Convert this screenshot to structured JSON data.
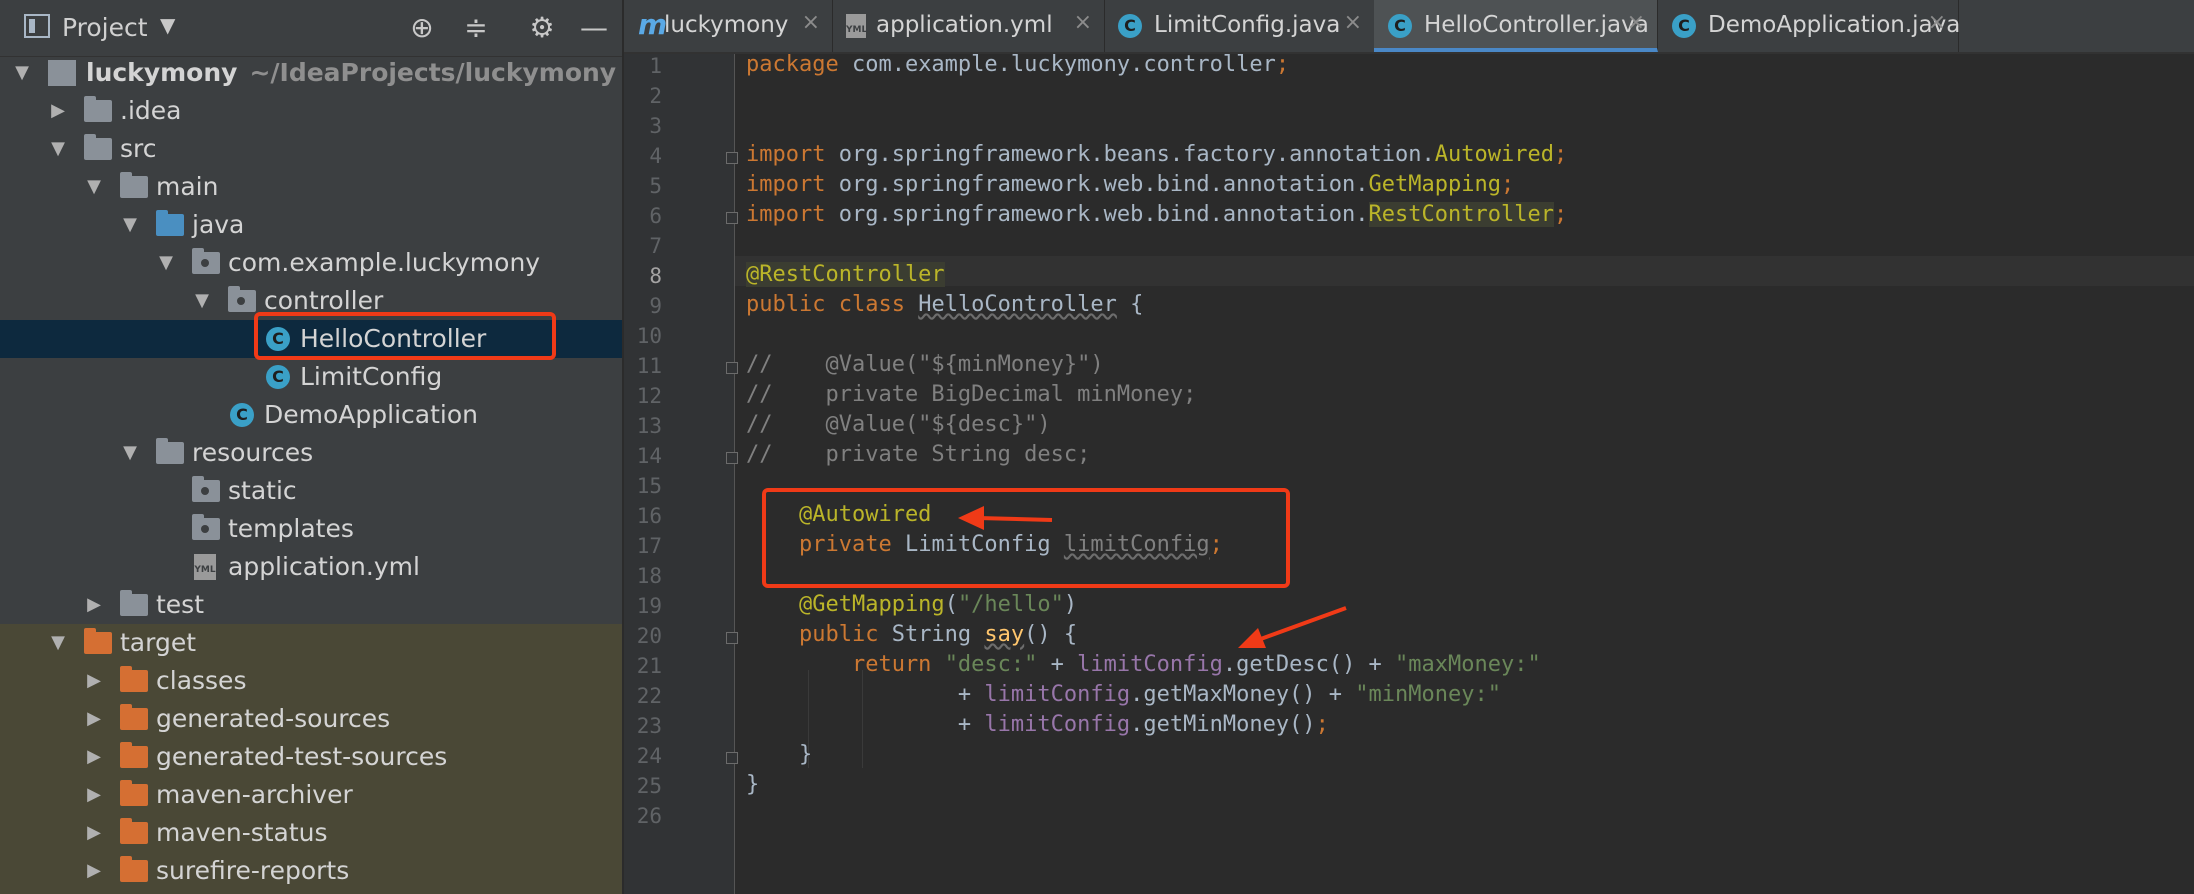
{
  "project_panel": {
    "title": "Project",
    "tree": [
      {
        "label": "luckymony",
        "sub": "~/IdeaProjects/luckymony"
      },
      {
        "label": ".idea"
      },
      {
        "label": "src"
      },
      {
        "label": "main"
      },
      {
        "label": "java"
      },
      {
        "label": "com.example.luckymony"
      },
      {
        "label": "controller"
      },
      {
        "label": "HelloController"
      },
      {
        "label": "LimitConfig"
      },
      {
        "label": "DemoApplication"
      },
      {
        "label": "resources"
      },
      {
        "label": "static"
      },
      {
        "label": "templates"
      },
      {
        "label": "application.yml"
      },
      {
        "label": "test"
      },
      {
        "label": "target"
      },
      {
        "label": "classes"
      },
      {
        "label": "generated-sources"
      },
      {
        "label": "generated-test-sources"
      },
      {
        "label": "maven-archiver"
      },
      {
        "label": "maven-status"
      },
      {
        "label": "surefire-reports"
      }
    ]
  },
  "tabs": [
    {
      "label": "luckymony",
      "icon": "m"
    },
    {
      "label": "application.yml",
      "icon": "YML"
    },
    {
      "label": "LimitConfig.java",
      "icon": "C"
    },
    {
      "label": "HelloController.java",
      "icon": "C"
    },
    {
      "label": "DemoApplication.java",
      "icon": "C"
    }
  ],
  "tab_close_glyph": "×",
  "line_numbers": [
    "1",
    "2",
    "3",
    "4",
    "5",
    "6",
    "7",
    "8",
    "9",
    "10",
    "11",
    "12",
    "13",
    "14",
    "15",
    "16",
    "17",
    "18",
    "19",
    "20",
    "21",
    "22",
    "23",
    "24",
    "25",
    "26"
  ],
  "code": {
    "l1": {
      "a": "package",
      "b": " com.example.luckymony.controller",
      "c": ";"
    },
    "l4": {
      "a": "import",
      "b": " org.springframework.beans.factory.annotation.",
      "c": "Autowired",
      "d": ";"
    },
    "l5": {
      "a": "import",
      "b": " org.springframework.web.bind.annotation.",
      "c": "GetMapping",
      "d": ";"
    },
    "l6": {
      "a": "import",
      "b": " org.springframework.web.bind.annotation.",
      "c": "RestController",
      "d": ";"
    },
    "l8": {
      "a": "@RestController"
    },
    "l9": {
      "a": "public class",
      "b": " ",
      "c": "HelloController",
      "d": " {"
    },
    "l11": "//    @Value(\"${minMoney}\")",
    "l12": "//    private BigDecimal minMoney;",
    "l13": "//    @Value(\"${desc}\")",
    "l14": "//    private String desc;",
    "l16": {
      "a": "    @Autowired"
    },
    "l17": {
      "a": "    private",
      "b": " LimitConfig ",
      "c": "limitConfig",
      "d": ";"
    },
    "l19": {
      "a": "    @GetMapping",
      "b": "(",
      "c": "\"/hello\"",
      "d": ")"
    },
    "l20": {
      "a": "    public",
      "b": " String ",
      "c": "say",
      "d": "() {"
    },
    "l21": {
      "a": "        return",
      "b": " ",
      "c": "\"desc:\"",
      "d": " + ",
      "e": "limitConfig",
      "f": ".getDesc() + ",
      "g": "\"maxMoney:\""
    },
    "l22": {
      "a": "                + ",
      "b": "limitConfig",
      "c": ".getMaxMoney() + ",
      "d": "\"minMoney:\""
    },
    "l23": {
      "a": "                + ",
      "b": "limitConfig",
      "c": ".getMinMoney()",
      "d": ";"
    },
    "l24": {
      "a": "    }"
    },
    "l25": {
      "a": "}"
    }
  },
  "colors": {
    "keyword": "#cc7832",
    "annotation": "#bbb529",
    "string": "#6a8759",
    "comment": "#808080",
    "field": "#9876aa",
    "highlight": "#f03a17"
  }
}
